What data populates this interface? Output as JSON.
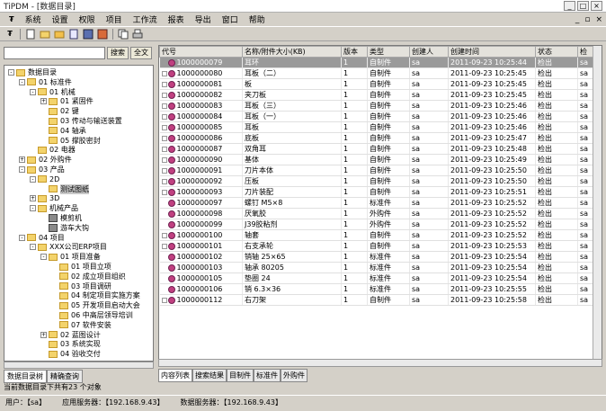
{
  "window": {
    "title": "TiPDM - [数据目录]",
    "min": "_",
    "max": "□",
    "close": "×"
  },
  "menu": [
    "系统",
    "设置",
    "权限",
    "项目",
    "工作流",
    "报表",
    "导出",
    "窗口",
    "帮助"
  ],
  "mdi_controls": [
    "_",
    "▫",
    "×"
  ],
  "search": {
    "value": "",
    "search_btn": "搜索",
    "full_btn": "全文"
  },
  "tree": [
    {
      "label": "数据目录",
      "level": 0,
      "exp": "-"
    },
    {
      "label": "01 标准件",
      "level": 1,
      "exp": "-"
    },
    {
      "label": "01 机械",
      "level": 2,
      "exp": "-"
    },
    {
      "label": "01 紧固件",
      "level": 3,
      "exp": "+"
    },
    {
      "label": "02 键",
      "level": 3,
      "exp": ""
    },
    {
      "label": "03 传动与输送装置",
      "level": 3,
      "exp": ""
    },
    {
      "label": "04 轴承",
      "level": 3,
      "exp": ""
    },
    {
      "label": "05 撑胶密封",
      "level": 3,
      "exp": ""
    },
    {
      "label": "02 电器",
      "level": 2,
      "exp": ""
    },
    {
      "label": "02 外购件",
      "level": 1,
      "exp": "+"
    },
    {
      "label": "03 产品",
      "level": 1,
      "exp": "-"
    },
    {
      "label": "2D",
      "level": 2,
      "exp": "-"
    },
    {
      "label": "测试图纸",
      "level": 3,
      "exp": "",
      "selected": true
    },
    {
      "label": "3D",
      "level": 2,
      "exp": "+"
    },
    {
      "label": "机械产品",
      "level": 2,
      "exp": "-"
    },
    {
      "label": "模剪机",
      "level": 3,
      "exp": "",
      "icon": "mach"
    },
    {
      "label": "游车大钩",
      "level": 3,
      "exp": "",
      "icon": "mach"
    },
    {
      "label": "04 项目",
      "level": 1,
      "exp": "-"
    },
    {
      "label": "XXX公司ERP项目",
      "level": 2,
      "exp": "-"
    },
    {
      "label": "01 项目准备",
      "level": 3,
      "exp": "-"
    },
    {
      "label": "01 项目立项",
      "level": 4,
      "exp": ""
    },
    {
      "label": "02 成立项目组织",
      "level": 4,
      "exp": ""
    },
    {
      "label": "03 项目调研",
      "level": 4,
      "exp": ""
    },
    {
      "label": "04 制定项目实施方案",
      "level": 4,
      "exp": ""
    },
    {
      "label": "05 开发项目启动大会",
      "level": 4,
      "exp": ""
    },
    {
      "label": "06 中高层领导培训",
      "level": 4,
      "exp": ""
    },
    {
      "label": "07 软件安装",
      "level": 4,
      "exp": ""
    },
    {
      "label": "02 蓝图设计",
      "level": 3,
      "exp": "+"
    },
    {
      "label": "03 系统实现",
      "level": 3,
      "exp": ""
    },
    {
      "label": "04 验收交付",
      "level": 3,
      "exp": ""
    }
  ],
  "left_tabs": [
    "数据目录树",
    "精确查询"
  ],
  "table": {
    "columns": [
      "代号",
      "名称/附件大小(KB)",
      "版本",
      "类型",
      "创建人",
      "创建时间",
      "状态",
      "检"
    ],
    "rows": [
      {
        "code": "1000000079",
        "name": "耳环",
        "ver": "1",
        "type": "自制件",
        "creator": "sa",
        "time": "2011-09-23 10:25:44",
        "status": "检出",
        "c": "sa",
        "hl": true,
        "exp": true
      },
      {
        "code": "1000000080",
        "name": "耳板（二）",
        "ver": "1",
        "type": "自制件",
        "creator": "sa",
        "time": "2011-09-23 10:25:45",
        "status": "检出",
        "c": "sa",
        "exp": true
      },
      {
        "code": "1000000081",
        "name": "板",
        "ver": "1",
        "type": "自制件",
        "creator": "sa",
        "time": "2011-09-23 10:25:45",
        "status": "检出",
        "c": "sa",
        "exp": true
      },
      {
        "code": "1000000082",
        "name": "夹刀板",
        "ver": "1",
        "type": "自制件",
        "creator": "sa",
        "time": "2011-09-23 10:25:45",
        "status": "检出",
        "c": "sa",
        "exp": true
      },
      {
        "code": "1000000083",
        "name": "耳板（三）",
        "ver": "1",
        "type": "自制件",
        "creator": "sa",
        "time": "2011-09-23 10:25:46",
        "status": "检出",
        "c": "sa",
        "exp": true
      },
      {
        "code": "1000000084",
        "name": "耳板（一）",
        "ver": "1",
        "type": "自制件",
        "creator": "sa",
        "time": "2011-09-23 10:25:46",
        "status": "检出",
        "c": "sa",
        "exp": true
      },
      {
        "code": "1000000085",
        "name": "耳板",
        "ver": "1",
        "type": "自制件",
        "creator": "sa",
        "time": "2011-09-23 10:25:46",
        "status": "检出",
        "c": "sa",
        "exp": true
      },
      {
        "code": "1000000086",
        "name": "底板",
        "ver": "1",
        "type": "自制件",
        "creator": "sa",
        "time": "2011-09-23 10:25:47",
        "status": "检出",
        "c": "sa",
        "exp": true
      },
      {
        "code": "1000000087",
        "name": "双角耳",
        "ver": "1",
        "type": "自制件",
        "creator": "sa",
        "time": "2011-09-23 10:25:48",
        "status": "检出",
        "c": "sa",
        "exp": true
      },
      {
        "code": "1000000090",
        "name": "基体",
        "ver": "1",
        "type": "自制件",
        "creator": "sa",
        "time": "2011-09-23 10:25:49",
        "status": "检出",
        "c": "sa",
        "exp": true
      },
      {
        "code": "1000000091",
        "name": "刀片本体",
        "ver": "1",
        "type": "自制件",
        "creator": "sa",
        "time": "2011-09-23 10:25:50",
        "status": "检出",
        "c": "sa",
        "exp": true
      },
      {
        "code": "1000000092",
        "name": "压板",
        "ver": "1",
        "type": "自制件",
        "creator": "sa",
        "time": "2011-09-23 10:25:50",
        "status": "检出",
        "c": "sa",
        "exp": true
      },
      {
        "code": "1000000093",
        "name": "刀片装配",
        "ver": "1",
        "type": "自制件",
        "creator": "sa",
        "time": "2011-09-23 10:25:51",
        "status": "检出",
        "c": "sa",
        "exp": true
      },
      {
        "code": "1000000097",
        "name": "螺钉 M5×8",
        "ver": "1",
        "type": "标准件",
        "creator": "sa",
        "time": "2011-09-23 10:25:52",
        "status": "检出",
        "c": "sa"
      },
      {
        "code": "1000000098",
        "name": "厌氧胶",
        "ver": "1",
        "type": "外购件",
        "creator": "sa",
        "time": "2011-09-23 10:25:52",
        "status": "检出",
        "c": "sa"
      },
      {
        "code": "1000000099",
        "name": "J39胶粘剂",
        "ver": "1",
        "type": "外购件",
        "creator": "sa",
        "time": "2011-09-23 10:25:52",
        "status": "检出",
        "c": "sa"
      },
      {
        "code": "1000000100",
        "name": "轴套",
        "ver": "1",
        "type": "自制件",
        "creator": "sa",
        "time": "2011-09-23 10:25:52",
        "status": "检出",
        "c": "sa",
        "exp": true
      },
      {
        "code": "1000000101",
        "name": "右支承轮",
        "ver": "1",
        "type": "自制件",
        "creator": "sa",
        "time": "2011-09-23 10:25:53",
        "status": "检出",
        "c": "sa",
        "exp": true
      },
      {
        "code": "1000000102",
        "name": "销轴 25×65",
        "ver": "1",
        "type": "标准件",
        "creator": "sa",
        "time": "2011-09-23 10:25:54",
        "status": "检出",
        "c": "sa"
      },
      {
        "code": "1000000103",
        "name": "轴承 80205",
        "ver": "1",
        "type": "标准件",
        "creator": "sa",
        "time": "2011-09-23 10:25:54",
        "status": "检出",
        "c": "sa"
      },
      {
        "code": "1000000105",
        "name": "垫圈 24",
        "ver": "1",
        "type": "标准件",
        "creator": "sa",
        "time": "2011-09-23 10:25:54",
        "status": "检出",
        "c": "sa"
      },
      {
        "code": "1000000106",
        "name": "销 6.3×36",
        "ver": "1",
        "type": "标准件",
        "creator": "sa",
        "time": "2011-09-23 10:25:55",
        "status": "检出",
        "c": "sa"
      },
      {
        "code": "1000000112",
        "name": "右刀架",
        "ver": "1",
        "type": "自制件",
        "creator": "sa",
        "time": "2011-09-23 10:25:58",
        "status": "检出",
        "c": "sa",
        "exp": true
      }
    ]
  },
  "right_tabs": [
    "内容列表",
    "搜索结果",
    "目制件",
    "标准件",
    "外购件"
  ],
  "info": "当前数据目录下共有23 个对象",
  "status": {
    "user": "用户：【sa】",
    "app_server": "应用服务器：【192.168.9.43】",
    "data_server": "数据服务器：【192.168.9.43】"
  }
}
